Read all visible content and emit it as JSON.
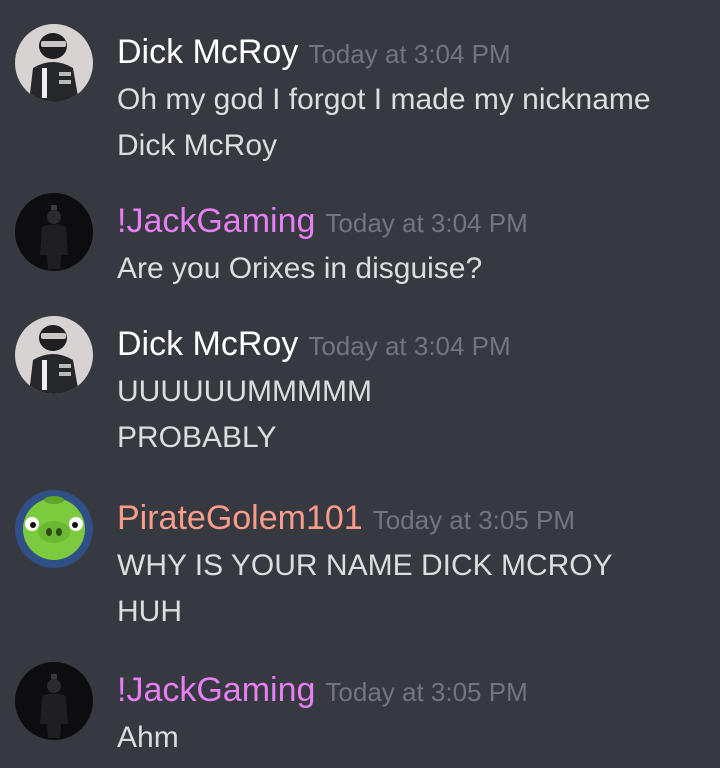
{
  "colors": {
    "background": "#36393f",
    "text": "#dcddde",
    "timestamp": "#72767d"
  },
  "messages": [
    {
      "author": "Dick McRoy",
      "author_color": "#ffffff",
      "avatar_icon": "masked-figure-avatar",
      "timestamp": "Today at 3:04 PM",
      "lines": [
        "Oh my god I forgot I made my nickname",
        "Dick McRoy"
      ]
    },
    {
      "author": "!JackGaming",
      "author_color": "#e67ff3",
      "avatar_icon": "dark-figure-avatar",
      "timestamp": "Today at 3:04 PM",
      "lines": [
        "Are you Orixes in disguise?"
      ]
    },
    {
      "author": "Dick McRoy",
      "author_color": "#ffffff",
      "avatar_icon": "masked-figure-avatar",
      "timestamp": "Today at 3:04 PM",
      "lines": [
        "UUUUUUMMMMM",
        "PROBABLY"
      ]
    },
    {
      "author": "PirateGolem101",
      "author_color": "#f99d8a",
      "avatar_icon": "green-pig-avatar",
      "timestamp": "Today at 3:05 PM",
      "lines": [
        "WHY IS YOUR NAME DICK MCROY",
        "HUH"
      ]
    },
    {
      "author": "!JackGaming",
      "author_color": "#e67ff3",
      "avatar_icon": "dark-figure-avatar",
      "timestamp": "Today at 3:05 PM",
      "lines": [
        "Ahm"
      ]
    }
  ]
}
